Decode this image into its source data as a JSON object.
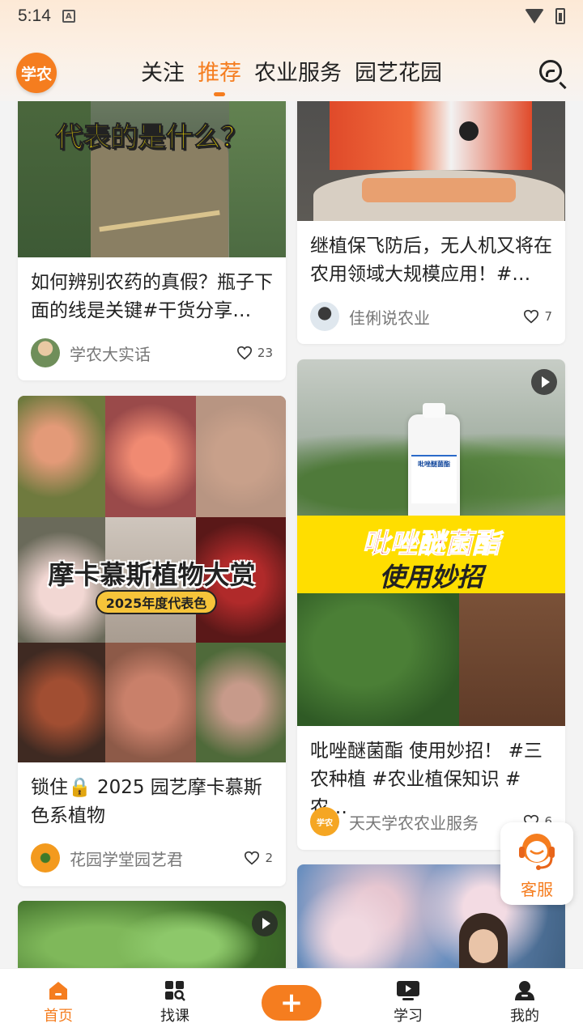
{
  "status_bar": {
    "time": "5:14",
    "notif_icon": "A"
  },
  "header": {
    "logo_text": "学农",
    "tabs": [
      "关注",
      "推荐",
      "农业服务",
      "园艺花园"
    ],
    "active_tab": "推荐",
    "accent": "#f57d1f"
  },
  "feed": {
    "card1": {
      "image_text": "代表的是什么？",
      "title": "如何辨别农药的真假？瓶子下面的线是关键#干货分享…",
      "author": "学农大实话",
      "likes": "23"
    },
    "card2": {
      "title": "继植保飞防后，无人机又将在农用领域大规模应用！#…",
      "author": "佳俐说农业",
      "likes": "7"
    },
    "card3": {
      "image_title": "摩卡慕斯植物大赏",
      "image_badge": "2025年度代表色",
      "title": "锁住🔒 2025 园艺摩卡慕斯色系植物",
      "author": "花园学堂园艺君",
      "likes": "2"
    },
    "card4": {
      "image_line1": "吡唑醚菌酯",
      "image_line2": "使用妙招",
      "bottle_label": "吡唑醚菌酯",
      "title": "吡唑醚菌酯 使用妙招！ #三农种植 #农业植保知识 #农…",
      "author": "天天学农农业服务",
      "likes": "6"
    }
  },
  "service_button": {
    "label": "客服"
  },
  "bottom_nav": {
    "items": [
      "首页",
      "找课",
      "",
      "学习",
      "我的"
    ],
    "plus": "+"
  }
}
